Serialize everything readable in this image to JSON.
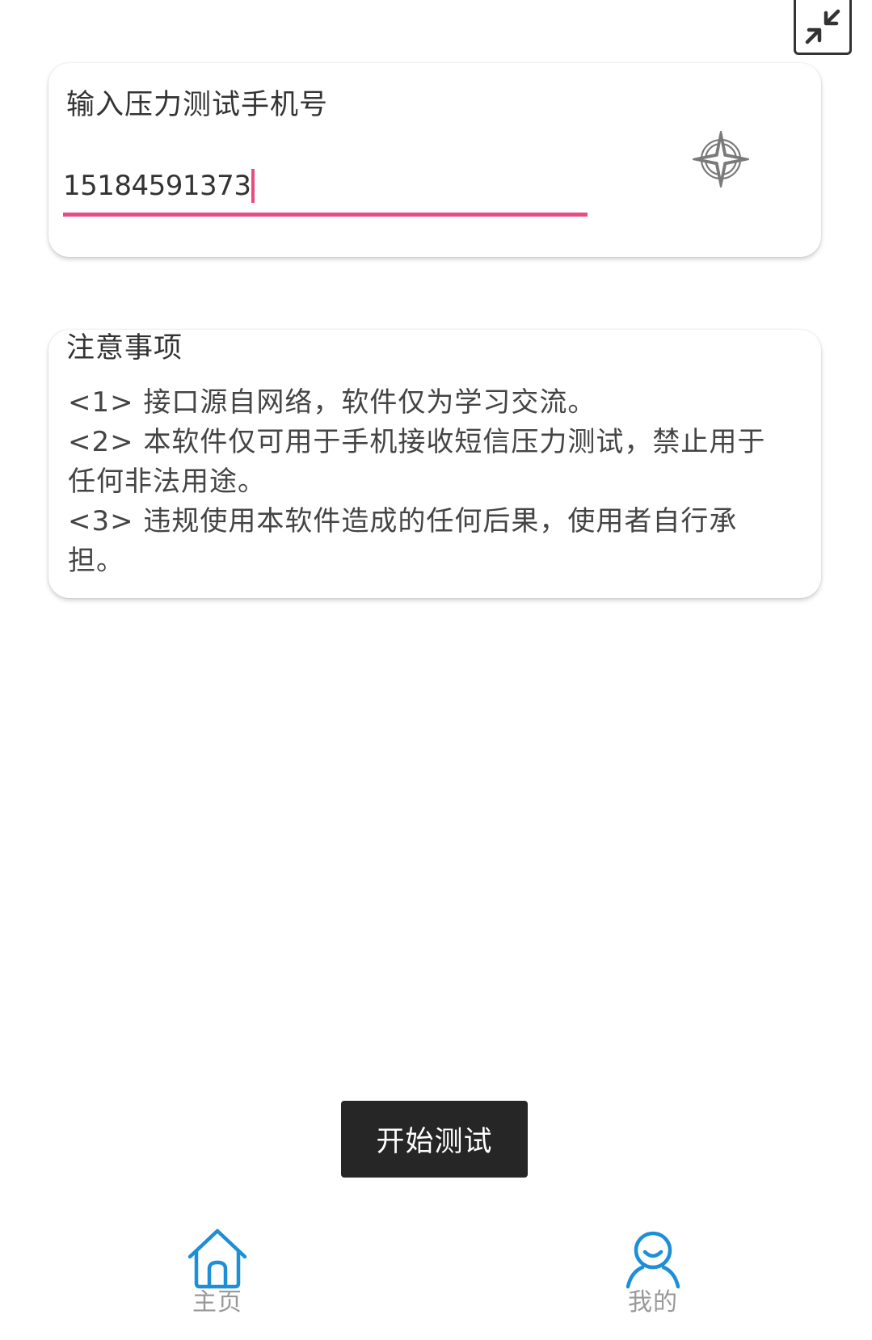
{
  "phone_card": {
    "label": "输入压力测试手机号",
    "phone_value": "15184591373"
  },
  "notice_card": {
    "title": "注意事项",
    "lines": [
      "<1> 接口源自网络，软件仅为学习交流。",
      "<2> 本软件仅可用于手机接收短信压力测试，禁止用于",
      "任何非法用途。",
      "<3> 违规使用本软件造成的任何后果，使用者自行承",
      "担。"
    ]
  },
  "actions": {
    "start_label": "开始测试"
  },
  "tabbar": {
    "home_label": "主页",
    "mine_label": "我的"
  },
  "icons": {
    "shrink": "shrink-icon",
    "target": "compass-target-icon",
    "home": "home-icon",
    "mine": "user-icon"
  },
  "colors": {
    "accent": "#e94b83",
    "tab_icon": "#1c8fd6",
    "button_bg": "#262626"
  }
}
